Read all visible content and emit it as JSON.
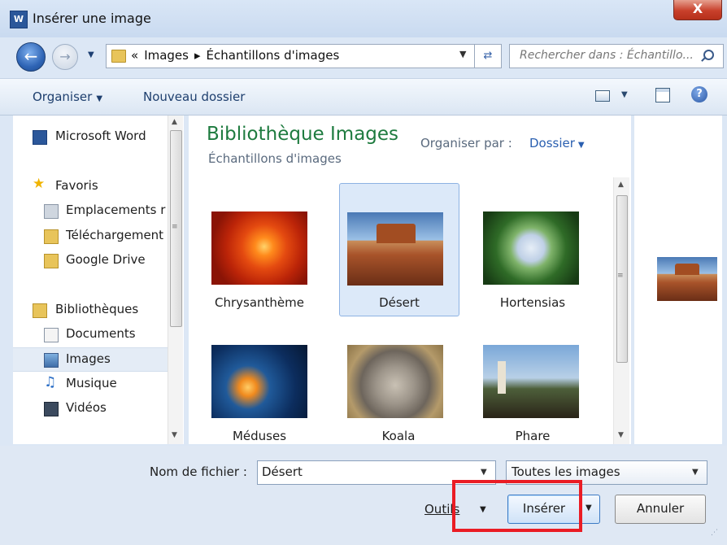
{
  "window": {
    "title": "Insérer une image",
    "app_icon": "word-icon",
    "close_label": "X"
  },
  "address": {
    "overflow": "«",
    "segments": [
      "Images",
      "Échantillons d'images"
    ],
    "separator": "▸",
    "search_placeholder": "Rechercher dans : Échantillo..."
  },
  "toolbar": {
    "organize_label": "Organiser",
    "new_folder_label": "Nouveau dossier"
  },
  "nav": {
    "items": [
      {
        "label": "Microsoft Word",
        "icon": "word-icon"
      },
      {
        "label": "Favoris",
        "icon": "star-icon"
      },
      {
        "label": "Emplacements r",
        "icon": "recent-places-icon"
      },
      {
        "label": "Téléchargement",
        "icon": "downloads-icon"
      },
      {
        "label": "Google Drive",
        "icon": "google-drive-icon"
      },
      {
        "label": "Bibliothèques",
        "icon": "libraries-icon"
      },
      {
        "label": "Documents",
        "icon": "documents-icon"
      },
      {
        "label": "Images",
        "icon": "images-icon",
        "selected": true
      },
      {
        "label": "Musique",
        "icon": "music-icon"
      },
      {
        "label": "Vidéos",
        "icon": "videos-icon"
      }
    ]
  },
  "library": {
    "title": "Bibliothèque Images",
    "subtitle": "Échantillons d'images",
    "arrange_label": "Organiser par :",
    "arrange_value": "Dossier"
  },
  "files": [
    {
      "name": "Chrysanthème",
      "selected": false
    },
    {
      "name": "Désert",
      "selected": true
    },
    {
      "name": "Hortensias",
      "selected": false
    },
    {
      "name": "Méduses",
      "selected": false
    },
    {
      "name": "Koala",
      "selected": false
    },
    {
      "name": "Phare",
      "selected": false
    }
  ],
  "footer": {
    "filename_label": "Nom de fichier :",
    "filename_value": "Désert",
    "filetype_value": "Toutes les images",
    "tools_label": "Outils",
    "insert_label": "Insérer",
    "cancel_label": "Annuler"
  },
  "colors": {
    "highlight": "#ea1c24",
    "library_title": "#1e7b3f",
    "link": "#2a5fb0"
  }
}
